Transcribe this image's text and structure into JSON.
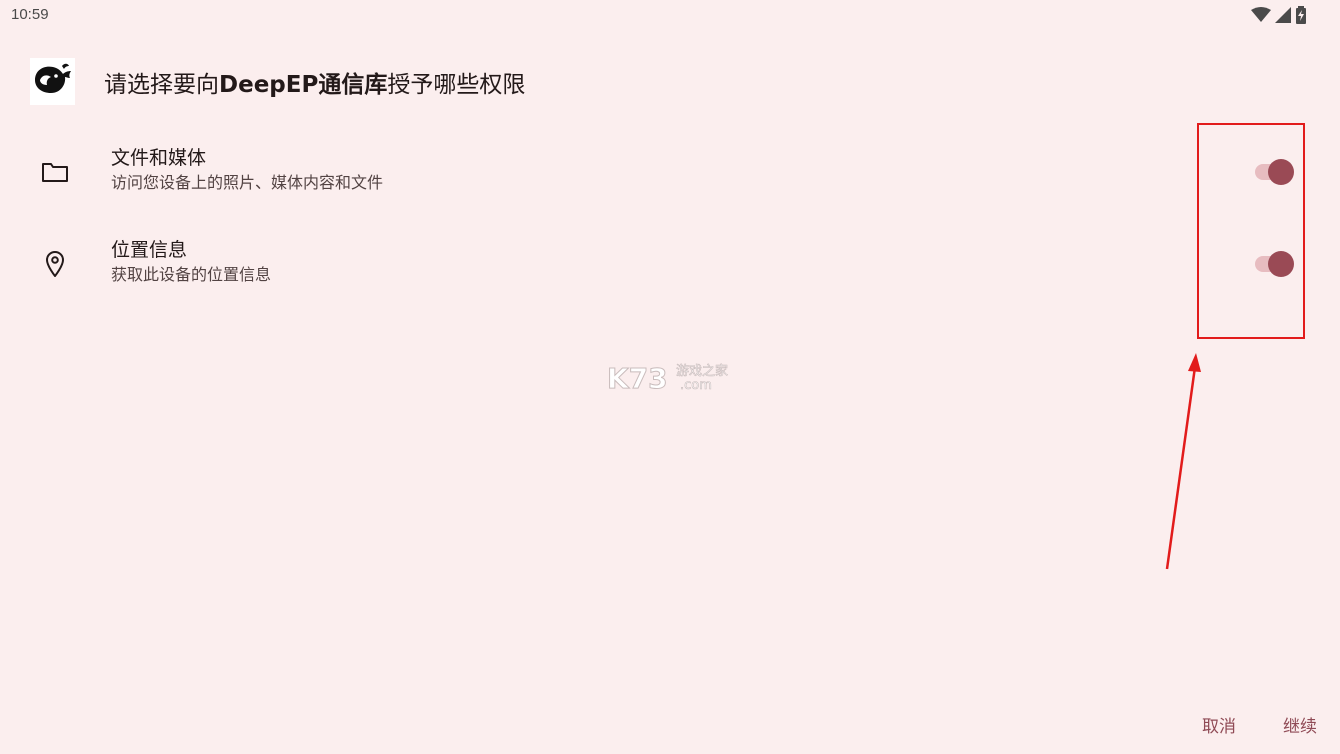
{
  "status_bar": {
    "time": "10:59",
    "icons": [
      "wifi-icon",
      "cellular-signal-icon",
      "battery-charging-icon"
    ]
  },
  "header": {
    "app_icon": "deepseek-whale-logo",
    "title_prefix": "请选择要向",
    "app_name": "DeepEP通信库",
    "title_suffix": "授予哪些权限"
  },
  "permissions": [
    {
      "icon": "folder-icon",
      "title": "文件和媒体",
      "description": "访问您设备上的照片、媒体内容和文件",
      "enabled": true
    },
    {
      "icon": "location-pin-icon",
      "title": "位置信息",
      "description": "获取此设备的位置信息",
      "enabled": true
    }
  ],
  "buttons": {
    "cancel": "取消",
    "continue": "继续"
  },
  "watermark": {
    "brand": "K73",
    "tagline": "游戏之家",
    "domain": ".com"
  },
  "colors": {
    "background": "#fbeeee",
    "accent": "#9a4a55",
    "switch_track": "#e7bcc0",
    "annotation": "#e21b1b"
  }
}
